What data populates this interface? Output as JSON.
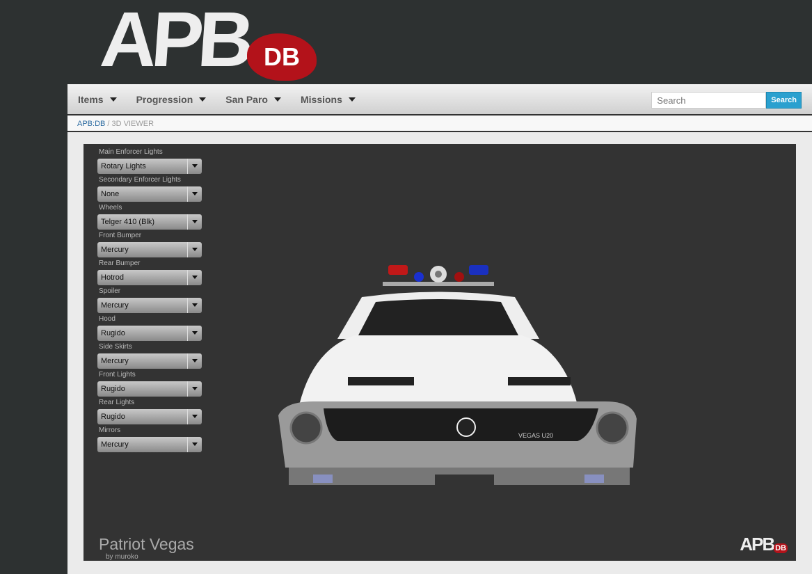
{
  "logo": {
    "text": "APB",
    "badge": "DB"
  },
  "nav": {
    "items": [
      "Items",
      "Progression",
      "San Paro",
      "Missions"
    ],
    "search_placeholder": "Search",
    "search_button": "Search"
  },
  "breadcrumb": {
    "home": "APB:DB",
    "sep": "/",
    "current": "3D VIEWER"
  },
  "options": [
    {
      "label": "Main Enforcer Lights",
      "value": "Rotary Lights"
    },
    {
      "label": "Secondary Enforcer Lights",
      "value": "None"
    },
    {
      "label": "Wheels",
      "value": "Telger 410 (Blk)"
    },
    {
      "label": "Front Bumper",
      "value": "Mercury"
    },
    {
      "label": "Rear Bumper",
      "value": "Hotrod"
    },
    {
      "label": "Spoiler",
      "value": "Mercury"
    },
    {
      "label": "Hood",
      "value": "Rugido"
    },
    {
      "label": "Side Skirts",
      "value": "Mercury"
    },
    {
      "label": "Front Lights",
      "value": "Rugido"
    },
    {
      "label": "Rear Lights",
      "value": "Rugido"
    },
    {
      "label": "Mirrors",
      "value": "Mercury"
    }
  ],
  "viewer": {
    "title": "Patriot Vegas",
    "author": "by muroko",
    "plate_badge": "VEGAS U20",
    "watermark": "APB",
    "watermark_badge": "DB"
  }
}
